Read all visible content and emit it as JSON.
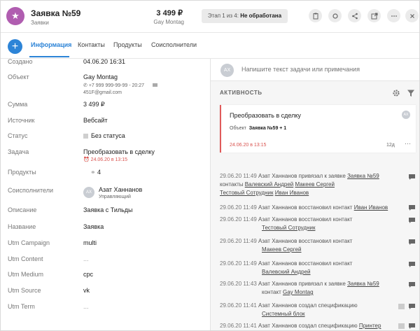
{
  "header": {
    "avatar_icon": "★",
    "title": "Заявка №59",
    "type": "Заявки",
    "amount": "3 499 ₽",
    "company": "Gay Montag",
    "stage_prefix": "Этап 1 из 4: ",
    "stage_name": "Не обработана",
    "icons": [
      "clipboard-icon",
      "refresh-icon",
      "share-icon",
      "external-link-icon",
      "more-icon",
      "close-icon"
    ]
  },
  "tabs": [
    {
      "label": "Информация",
      "active": true
    },
    {
      "label": "Контакты",
      "active": false
    },
    {
      "label": "Продукты",
      "active": false
    },
    {
      "label": "Соисполнители",
      "active": false
    }
  ],
  "fields": {
    "created": {
      "label": "Создано",
      "value": "04.06.20 16:31"
    },
    "object": {
      "label": "Объект",
      "value": "Gay Montag",
      "phone": "+7 999 999-99-99 - 20:27",
      "email": "451F@gmail.com"
    },
    "sum": {
      "label": "Сумма",
      "value": "3 499 ₽"
    },
    "source": {
      "label": "Источник",
      "value": "Вебсайт"
    },
    "status": {
      "label": "Статус",
      "value": "Без статуса"
    },
    "task": {
      "label": "Задача",
      "value": "Преобразовать в сделку",
      "due": "24.06.20 в 13:15"
    },
    "products": {
      "label": "Продукты",
      "value": "4"
    },
    "coexecutors": {
      "label": "Соисполнители",
      "avatar": "AX",
      "name": "Азат Ханнанов",
      "role": "Управляющий"
    },
    "description": {
      "label": "Описание",
      "value": "Заявка с Тильды"
    },
    "name": {
      "label": "Название",
      "value": "Заявка"
    },
    "utm_campaign": {
      "label": "Utm Campaign",
      "value": "multi"
    },
    "utm_content": {
      "label": "Utm Content",
      "value": "..."
    },
    "utm_medium": {
      "label": "Utm Medium",
      "value": "cpc"
    },
    "utm_source": {
      "label": "Utm Source",
      "value": "vk"
    },
    "utm_term": {
      "label": "Utm Term",
      "value": "..."
    }
  },
  "task_input": {
    "avatar": "AX",
    "placeholder": "Напишите текст задачи или примечания"
  },
  "activity": {
    "title": "АКТИВНОСТЬ",
    "card": {
      "title": "Преобразовать в сделку",
      "avatar": "AX",
      "object_label": "Объект",
      "object_value": "Заявка №59 + 1",
      "date": "24.06.20 в 13:15",
      "age": "12д",
      "more": "···"
    },
    "log": [
      {
        "time": "29.06.20 11:49",
        "text": "Азат Ханнанов привязал к заявке",
        "link": "Заявка №59",
        "line2_text": "контакты",
        "line2_links": [
          "Валевский Андрей",
          "Макеев Сергей"
        ],
        "line3_links": [
          "Тестовый Сотрудник",
          "Иван Иванов"
        ]
      },
      {
        "time": "29.06.20 11:49",
        "text": "Азат Ханнанов восстановил контакт",
        "link": "Иван Иванов"
      },
      {
        "time": "29.06.20 11:49",
        "text": "Азат Ханнанов восстановил контакт",
        "line2_links": [
          "Тестовый Сотрудник"
        ]
      },
      {
        "time": "29.06.20 11:49",
        "text": "Азат Ханнанов восстановил контакт",
        "line2_links": [
          "Макеев Сергей"
        ]
      },
      {
        "time": "29.06.20 11:49",
        "text": "Азат Ханнанов восстановил контакт",
        "line2_links": [
          "Валевский Андрей"
        ]
      },
      {
        "time": "29.06.20 11:43",
        "text": "Азат Ханнанов привязал к заявке",
        "link": "Заявка №59",
        "line2_text": "контакт",
        "line2_links": [
          "Gay Montag"
        ]
      },
      {
        "time": "29.06.20 11:41",
        "text": "Азат Ханнанов создал спецификацию",
        "line2_links": [
          "Системный блок"
        ]
      },
      {
        "time": "29.06.20 11:41",
        "text": "Азат Ханнанов создал спецификацию",
        "link": "Принтер"
      }
    ]
  }
}
